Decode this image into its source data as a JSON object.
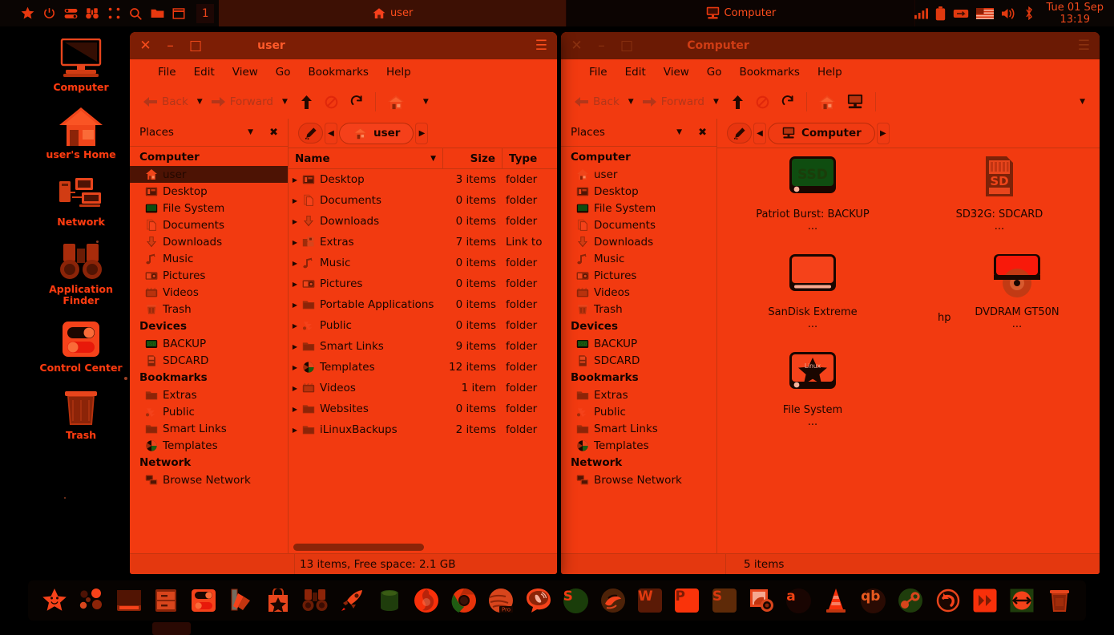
{
  "theme": {
    "accent": "#f23a10",
    "titlebar": "#7d1e05",
    "text_dark": "#1c0600",
    "panel_bg": "#0a0503",
    "selection": "#4d1304",
    "desktop_label": "#ff3c10"
  },
  "top_panel": {
    "launchers": [
      {
        "name": "whisker-menu-star-icon",
        "glyph": "star"
      },
      {
        "name": "power-icon",
        "glyph": "power"
      },
      {
        "name": "toggle-switch-icon",
        "glyph": "toggle"
      },
      {
        "name": "binoculars-icon",
        "glyph": "binoculars"
      },
      {
        "name": "app-grid-icon",
        "glyph": "grid"
      },
      {
        "name": "search-icon",
        "glyph": "search"
      },
      {
        "name": "folder-icon",
        "glyph": "folder"
      },
      {
        "name": "window-icon",
        "glyph": "window"
      }
    ],
    "workspace": "1",
    "tasks": [
      {
        "label": "user",
        "icon": "home-icon",
        "active": true
      },
      {
        "label": "Computer",
        "icon": "monitor-icon",
        "active": false
      }
    ],
    "tray": [
      {
        "name": "signal-bars-icon"
      },
      {
        "name": "battery-icon"
      },
      {
        "name": "network-icon"
      },
      {
        "name": "keyboard-layout-us-flag-icon"
      },
      {
        "name": "volume-icon"
      },
      {
        "name": "bluetooth-icon"
      }
    ],
    "clock": {
      "date": "Tue 01 Sep",
      "time": "13:19"
    }
  },
  "desktop_icons": [
    {
      "label": "Computer",
      "icon": "monitor-icon"
    },
    {
      "label": "user's Home",
      "icon": "home-icon"
    },
    {
      "label": "Network",
      "icon": "network-computers-icon"
    },
    {
      "label": "Application Finder",
      "icon": "binoculars-icon"
    },
    {
      "label": "Control Center",
      "icon": "toggle-switches-icon"
    },
    {
      "label": "Trash",
      "icon": "trash-icon"
    }
  ],
  "window_user": {
    "title": "user",
    "active": true,
    "controls": {
      "close": "✕",
      "minimize": "–",
      "maximize": "□",
      "menu": "☰"
    },
    "menus": [
      "File",
      "Edit",
      "View",
      "Go",
      "Bookmarks",
      "Help"
    ],
    "toolbar": {
      "back": "Back",
      "forward": "Forward",
      "up_icon": "arrow-up-icon",
      "stop_icon": "stop-icon",
      "reload_icon": "reload-icon",
      "home_icon": "home-icon",
      "overflow_icon": "chevron-down-icon"
    },
    "sidebar": {
      "header": "Places",
      "groups": [
        {
          "title": "Computer",
          "items": [
            {
              "label": "user",
              "icon": "home-icon",
              "selected": true
            },
            {
              "label": "Desktop",
              "icon": "desktop-icon",
              "selected": false
            },
            {
              "label": "File System",
              "icon": "drive-icon",
              "selected": false
            },
            {
              "label": "Documents",
              "icon": "documents-icon",
              "selected": false
            },
            {
              "label": "Downloads",
              "icon": "downloads-icon",
              "selected": false
            },
            {
              "label": "Music",
              "icon": "music-icon",
              "selected": false
            },
            {
              "label": "Pictures",
              "icon": "pictures-icon",
              "selected": false
            },
            {
              "label": "Videos",
              "icon": "videos-icon",
              "selected": false
            },
            {
              "label": "Trash",
              "icon": "trash-icon",
              "selected": false
            }
          ]
        },
        {
          "title": "Devices",
          "items": [
            {
              "label": "BACKUP",
              "icon": "ssd-icon",
              "selected": false
            },
            {
              "label": "SDCARD",
              "icon": "sdcard-icon",
              "selected": false
            }
          ]
        },
        {
          "title": "Bookmarks",
          "items": [
            {
              "label": "Extras",
              "icon": "folder-icon",
              "selected": false
            },
            {
              "label": "Public",
              "icon": "public-share-icon",
              "selected": false
            },
            {
              "label": "Smart Links",
              "icon": "folder-icon",
              "selected": false
            },
            {
              "label": "Templates",
              "icon": "templates-icon",
              "selected": false
            }
          ]
        },
        {
          "title": "Network",
          "items": [
            {
              "label": "Browse Network",
              "icon": "network-icon",
              "selected": false
            }
          ]
        }
      ]
    },
    "pathbar": {
      "edit_icon": "pencil-icon",
      "prev_icon": "chevron-left-icon",
      "next_icon": "chevron-right-icon",
      "crumb": "user",
      "crumb_icon": "home-icon"
    },
    "columns": {
      "name": "Name",
      "size": "Size",
      "type": "Type"
    },
    "rows": [
      {
        "name": "Desktop",
        "size": "3 items",
        "type": "folder",
        "icon": "desktop-icon"
      },
      {
        "name": "Documents",
        "size": "0 items",
        "type": "folder",
        "icon": "documents-icon"
      },
      {
        "name": "Downloads",
        "size": "0 items",
        "type": "folder",
        "icon": "downloads-icon"
      },
      {
        "name": "Extras",
        "size": "7 items",
        "type": "Link to",
        "icon": "lock-folder-icon"
      },
      {
        "name": "Music",
        "size": "0 items",
        "type": "folder",
        "icon": "music-icon"
      },
      {
        "name": "Pictures",
        "size": "0 items",
        "type": "folder",
        "icon": "pictures-icon"
      },
      {
        "name": "Portable Applications",
        "size": "0 items",
        "type": "folder",
        "icon": "folder-icon"
      },
      {
        "name": "Public",
        "size": "0 items",
        "type": "folder",
        "icon": "public-share-icon"
      },
      {
        "name": "Smart Links",
        "size": "9 items",
        "type": "folder",
        "icon": "folder-icon"
      },
      {
        "name": "Templates",
        "size": "12 items",
        "type": "folder",
        "icon": "templates-icon"
      },
      {
        "name": "Videos",
        "size": "1 item",
        "type": "folder",
        "icon": "videos-icon"
      },
      {
        "name": "Websites",
        "size": "0 items",
        "type": "folder",
        "icon": "folder-icon"
      },
      {
        "name": "iLinuxBackups",
        "size": "2 items",
        "type": "folder",
        "icon": "folder-icon"
      }
    ],
    "status": "13 items, Free space: 2.1 GB"
  },
  "window_computer": {
    "title": "Computer",
    "active": false,
    "controls": {
      "close": "✕",
      "minimize": "–",
      "maximize": "□",
      "menu": "☰"
    },
    "menus": [
      "File",
      "Edit",
      "View",
      "Go",
      "Bookmarks",
      "Help"
    ],
    "toolbar": {
      "back": "Back",
      "forward": "Forward",
      "up_icon": "arrow-up-icon",
      "stop_icon": "stop-icon",
      "reload_icon": "reload-icon",
      "home_icon": "home-icon",
      "computer_icon": "monitor-icon",
      "overflow_icon": "chevron-down-icon"
    },
    "sidebar": {
      "header": "Places",
      "groups": [
        {
          "title": "Computer",
          "items": [
            {
              "label": "user",
              "icon": "home-icon",
              "selected": false
            },
            {
              "label": "Desktop",
              "icon": "desktop-icon",
              "selected": false
            },
            {
              "label": "File System",
              "icon": "drive-icon",
              "selected": false
            },
            {
              "label": "Documents",
              "icon": "documents-icon",
              "selected": false
            },
            {
              "label": "Downloads",
              "icon": "downloads-icon",
              "selected": false
            },
            {
              "label": "Music",
              "icon": "music-icon",
              "selected": false
            },
            {
              "label": "Pictures",
              "icon": "pictures-icon",
              "selected": false
            },
            {
              "label": "Videos",
              "icon": "videos-icon",
              "selected": false
            },
            {
              "label": "Trash",
              "icon": "trash-icon",
              "selected": false
            }
          ]
        },
        {
          "title": "Devices",
          "items": [
            {
              "label": "BACKUP",
              "icon": "ssd-icon",
              "selected": false
            },
            {
              "label": "SDCARD",
              "icon": "sdcard-icon",
              "selected": false
            }
          ]
        },
        {
          "title": "Bookmarks",
          "items": [
            {
              "label": "Extras",
              "icon": "folder-icon",
              "selected": false
            },
            {
              "label": "Public",
              "icon": "public-share-icon",
              "selected": false
            },
            {
              "label": "Smart Links",
              "icon": "folder-icon",
              "selected": false
            },
            {
              "label": "Templates",
              "icon": "templates-icon",
              "selected": false
            }
          ]
        },
        {
          "title": "Network",
          "items": [
            {
              "label": "Browse Network",
              "icon": "network-icon",
              "selected": false
            }
          ]
        }
      ]
    },
    "pathbar": {
      "edit_icon": "pencil-icon",
      "prev_icon": "chevron-left-icon",
      "next_icon": "chevron-right-icon",
      "crumb": "Computer",
      "crumb_icon": "monitor-icon"
    },
    "items": [
      {
        "label": "Patriot Burst: BACKUP",
        "sub": "...",
        "icon": "ssd-drive-icon"
      },
      {
        "label": "SD32G: SDCARD",
        "sub": "...",
        "icon": "sdcard-icon"
      },
      {
        "label": "SanDisk Extreme",
        "sub": "...",
        "icon": "hard-drive-icon"
      },
      {
        "label": "DVDRAM GT50N",
        "sub": "...",
        "icon": "optical-drive-icon"
      },
      {
        "label": "File System",
        "sub": "...",
        "icon": "linux-drive-icon"
      }
    ],
    "extra_label": "hp",
    "status": "5 items"
  },
  "dock": [
    {
      "name": "dock-whisker-star",
      "kind": "star-smiley"
    },
    {
      "name": "dock-app-grid",
      "kind": "dots"
    },
    {
      "name": "dock-terminal",
      "kind": "terminal"
    },
    {
      "name": "dock-file-cabinet",
      "kind": "cabinet"
    },
    {
      "name": "dock-control-center",
      "kind": "toggles"
    },
    {
      "name": "dock-color-palette",
      "kind": "palette"
    },
    {
      "name": "dock-software-store",
      "kind": "bag-star"
    },
    {
      "name": "dock-app-finder",
      "kind": "binoculars"
    },
    {
      "name": "dock-rocket",
      "kind": "rocket"
    },
    {
      "name": "dock-trash-cylinder",
      "kind": "cylinder"
    },
    {
      "name": "dock-firefox",
      "kind": "firefox"
    },
    {
      "name": "dock-chrome",
      "kind": "chrome"
    },
    {
      "name": "dock-opera-pro",
      "kind": "opera",
      "badge": "Pro"
    },
    {
      "name": "dock-viber",
      "kind": "viber"
    },
    {
      "name": "dock-skype",
      "kind": "letter",
      "letter": "S",
      "shape": "circle",
      "bg": "#1a3d0a",
      "fg": "#f03a12"
    },
    {
      "name": "dock-mask-app",
      "kind": "mask"
    },
    {
      "name": "dock-wps-writer",
      "kind": "letter",
      "letter": "W",
      "shape": "square",
      "bg": "#5a1a06",
      "fg": "#e03a10"
    },
    {
      "name": "dock-wps-present",
      "kind": "letter",
      "letter": "P",
      "shape": "square",
      "bg": "#fa330a",
      "fg": "#7d1b04"
    },
    {
      "name": "dock-wps-spreadsheet",
      "kind": "letter",
      "letter": "S",
      "shape": "square",
      "bg": "#5e2a08",
      "fg": "#d8380f"
    },
    {
      "name": "dock-screenshot",
      "kind": "screenshot"
    },
    {
      "name": "dock-audio-app",
      "kind": "letter",
      "letter": "a",
      "shape": "circle",
      "bg": "#190502",
      "fg": "#f24212"
    },
    {
      "name": "dock-vlc",
      "kind": "cone"
    },
    {
      "name": "dock-qbittorrent",
      "kind": "letter",
      "letter": "qb",
      "shape": "circle",
      "bg": "#2a0b03",
      "fg": "#e8591f"
    },
    {
      "name": "dock-steam",
      "kind": "steam"
    },
    {
      "name": "dock-restore",
      "kind": "undo"
    },
    {
      "name": "dock-fast-forward",
      "kind": "forward"
    },
    {
      "name": "dock-teamviewer",
      "kind": "teamviewer"
    },
    {
      "name": "dock-trash",
      "kind": "trashbin"
    }
  ]
}
